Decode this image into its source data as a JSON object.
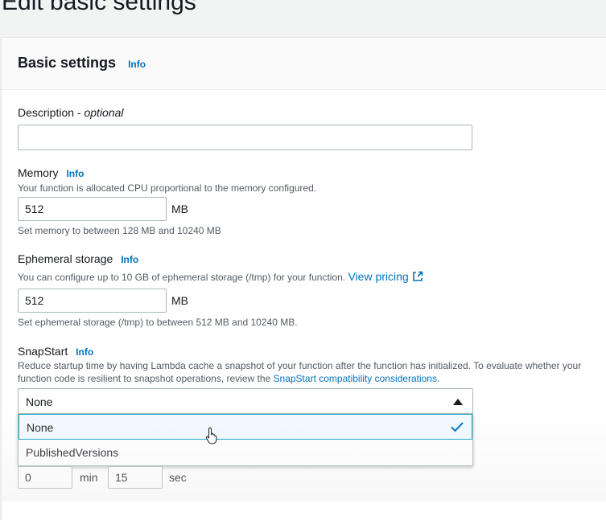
{
  "page": {
    "title": "Edit basic settings"
  },
  "basic_settings": {
    "title": "Basic settings",
    "info": "Info"
  },
  "description": {
    "label": "Description",
    "optional": "optional",
    "separator": " - ",
    "value": ""
  },
  "memory": {
    "label": "Memory",
    "info": "Info",
    "help": "Your function is allocated CPU proportional to the memory configured.",
    "value": "512",
    "unit": "MB",
    "constraint": "Set memory to between 128 MB and 10240 MB"
  },
  "ephemeral": {
    "label": "Ephemeral storage",
    "info": "Info",
    "help": "You can configure up to 10 GB of ephemeral storage (/tmp) for your function.",
    "link": "View pricing",
    "value": "512",
    "unit": "MB",
    "constraint": "Set ephemeral storage (/tmp) to between 512 MB and 10240 MB."
  },
  "snapstart": {
    "label": "SnapStart",
    "info": "Info",
    "help_line1": "Reduce startup time by having Lambda cache a snapshot of your function after the function has initialized. To evaluate whether your",
    "help_line2": "function code is resilient to snapshot operations, review the",
    "link": "SnapStart compatibility considerations",
    "help_end": ".",
    "selected": "None",
    "options": [
      "None",
      "PublishedVersions"
    ]
  },
  "timeout": {
    "minutes": "0",
    "min_unit": "min",
    "seconds": "15",
    "sec_unit": "sec"
  },
  "icons": {
    "external": "external-link-icon",
    "check": "check-icon",
    "caret": "caret-up-icon",
    "cursor": "hand-cursor-icon"
  },
  "colors": {
    "link": "#0073bb",
    "selected_bg": "#f1faff",
    "selected_border": "#00a1c9",
    "check": "#0073bb"
  }
}
